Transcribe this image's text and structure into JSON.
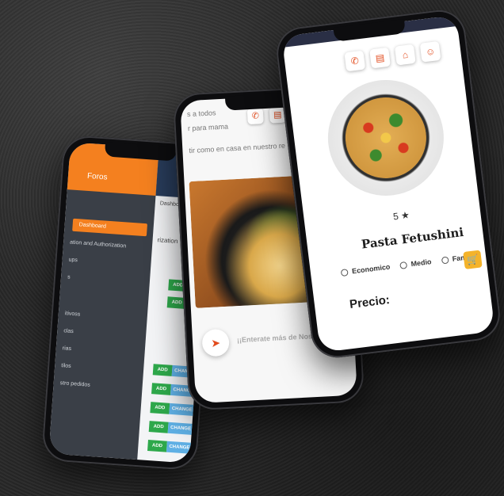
{
  "phone_admin": {
    "brand": "Foros",
    "top_url": "web",
    "breadcrumb": "Dashboard",
    "sidebar": [
      {
        "label": "Dashboard",
        "active": true
      },
      {
        "label": "ation and Authorization"
      },
      {
        "label": "ups"
      },
      {
        "label": "s"
      },
      {
        "label": "itivoss"
      },
      {
        "label": "clas"
      },
      {
        "label": "rias"
      },
      {
        "label": "tilos"
      },
      {
        "label": "stro pedidos"
      }
    ],
    "section_label": "rization",
    "add_label": "ADD",
    "change_label": "CHANGE"
  },
  "phone_home": {
    "text_lines": [
      "s a todos",
      "r para mama",
      "tir como en casa en nuestro re"
    ],
    "promo": "¡¡Enterate más de Nosotro"
  },
  "phone_product": {
    "rating": "5",
    "product_name": "Pasta Fetushini",
    "options": [
      "Economico",
      "Medio",
      "Familiar"
    ],
    "price_label": "Precio:"
  },
  "colors": {
    "accent_orange": "#f4801f",
    "navy": "#293d5c",
    "add_green": "#2ea84b",
    "change_blue": "#5fb0e5",
    "icon_red": "#e24c1e",
    "cart_yellow": "#f4b32a"
  }
}
